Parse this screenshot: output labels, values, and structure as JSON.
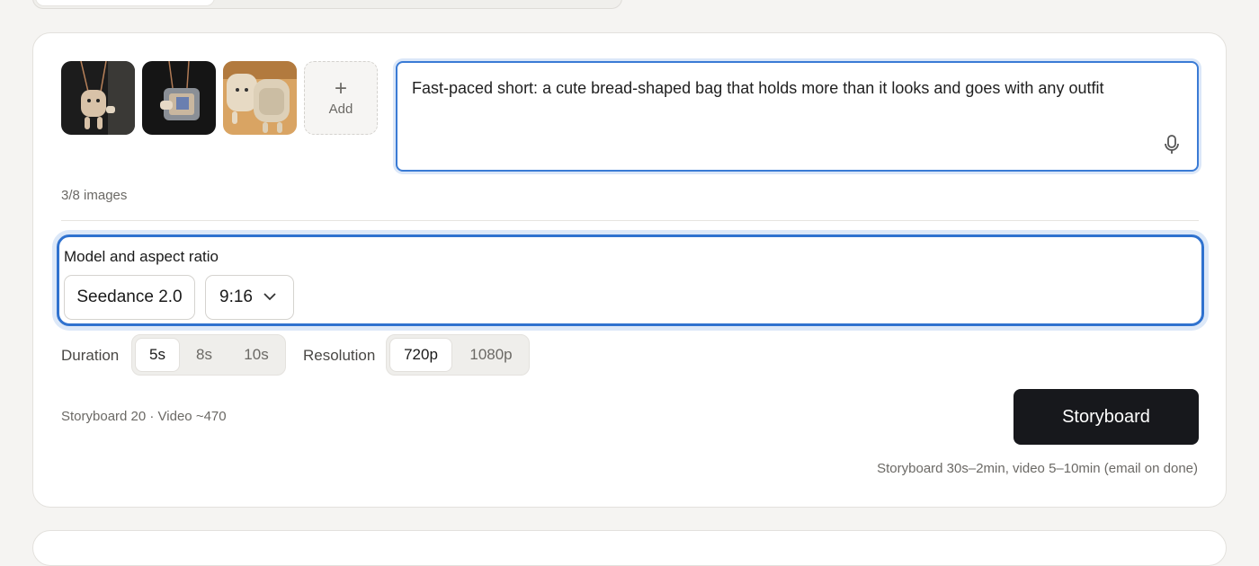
{
  "images": {
    "add_label": "Add",
    "count_label": "3/8 images",
    "thumbnails": [
      "thumbnail-1",
      "thumbnail-2",
      "thumbnail-3"
    ]
  },
  "prompt": {
    "value": "Fast-paced short: a cute bread-shaped bag that holds more than it looks and goes with any outfit"
  },
  "model_section": {
    "title": "Model and aspect ratio",
    "model_value": "Seedance 2.0",
    "ratio_value": "9:16"
  },
  "duration": {
    "label": "Duration",
    "options": [
      "5s",
      "8s",
      "10s"
    ],
    "selected": "5s"
  },
  "resolution": {
    "label": "Resolution",
    "options": [
      "720p",
      "1080p"
    ],
    "selected": "720p"
  },
  "footer": {
    "cost_label": "Storyboard 20 · Video ~470",
    "primary_button": "Storyboard",
    "hint": "Storyboard 30s–2min, video 5–10min (email on done)"
  },
  "colors": {
    "accent": "#2f72cf",
    "primary_button": "#17181c"
  },
  "icons": {
    "add": "plus-icon",
    "mic": "microphone-icon",
    "dropdown": "chevron-down-icon"
  }
}
